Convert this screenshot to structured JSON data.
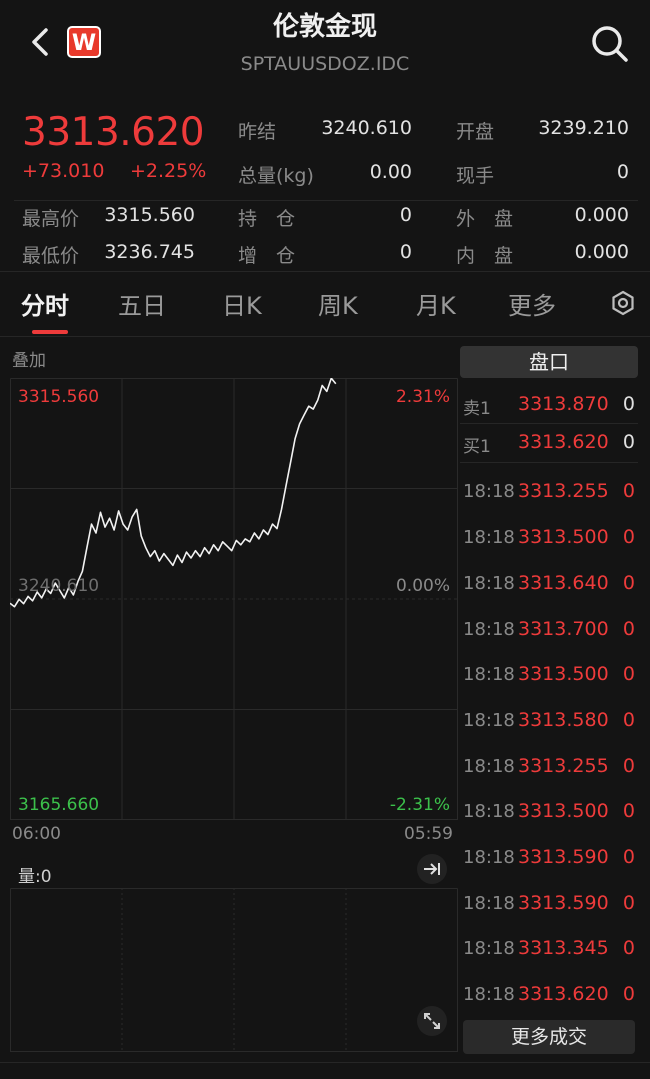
{
  "header": {
    "title": "伦敦金现",
    "subtitle": "SPTAUUSDOZ.IDC",
    "logo_letter": "W"
  },
  "quote": {
    "price": "3313.620",
    "change": "+73.010",
    "change_pct": "+2.25%",
    "fields": [
      {
        "label": "昨结",
        "value": "3240.610"
      },
      {
        "label": "开盘",
        "value": "3239.210"
      },
      {
        "label": "总量(kg)",
        "value": "0.00"
      },
      {
        "label": "现手",
        "value": "0"
      },
      {
        "label": "最高价",
        "value": "3315.560"
      },
      {
        "label": "持　仓",
        "value": "0"
      },
      {
        "label": "外　盘",
        "value": "0.000"
      },
      {
        "label": "最低价",
        "value": "3236.745"
      },
      {
        "label": "增　仓",
        "value": "0"
      },
      {
        "label": "内　盘",
        "value": "0.000"
      }
    ]
  },
  "tabs": [
    {
      "label": "分时",
      "active": true
    },
    {
      "label": "五日"
    },
    {
      "label": "日K"
    },
    {
      "label": "周K"
    },
    {
      "label": "月K"
    },
    {
      "label": "更多"
    }
  ],
  "chart_panel": {
    "overlay_label": "叠加",
    "volume_label": "量:0",
    "time_start": "06:00",
    "time_end": "05:59"
  },
  "chart_data": {
    "type": "line",
    "y_top_label": "3315.560",
    "y_mid_label": "3240.610",
    "y_bottom_label": "3165.660",
    "pct_top_label": "2.31%",
    "pct_mid_label": "0.00%",
    "pct_bottom_label": "-2.31%",
    "ylim": [
      3165.66,
      3315.56
    ],
    "x_total_points": 100,
    "values": [
      3239.2,
      3238.0,
      3240.5,
      3239.0,
      3241.5,
      3240.0,
      3243.0,
      3241.0,
      3244.0,
      3242.5,
      3246.0,
      3243.5,
      3241.0,
      3244.5,
      3242.0,
      3246.5,
      3250.0,
      3258.0,
      3266.0,
      3263.0,
      3270.0,
      3265.0,
      3268.0,
      3264.0,
      3270.5,
      3266.0,
      3264.0,
      3268.5,
      3271.0,
      3262.0,
      3258.0,
      3255.0,
      3257.0,
      3253.5,
      3256.0,
      3254.0,
      3252.0,
      3255.5,
      3253.0,
      3256.5,
      3254.5,
      3257.0,
      3255.0,
      3258.0,
      3256.0,
      3259.0,
      3257.0,
      3260.0,
      3258.5,
      3257.0,
      3260.5,
      3259.0,
      3261.0,
      3260.0,
      3263.0,
      3261.0,
      3264.0,
      3262.5,
      3266.0,
      3264.5,
      3271.0,
      3279.0,
      3287.0,
      3295.0,
      3300.0,
      3303.0,
      3306.0,
      3305.0,
      3308.0,
      3313.0,
      3311.0,
      3315.5,
      3313.6
    ]
  },
  "order_book": {
    "header": "盘口",
    "rows": [
      {
        "label": "卖1",
        "price": "3313.870",
        "qty": "0"
      },
      {
        "label": "买1",
        "price": "3313.620",
        "qty": "0"
      }
    ]
  },
  "trades": {
    "rows": [
      {
        "time": "18:18",
        "price": "3313.255",
        "qty": "0"
      },
      {
        "time": "18:18",
        "price": "3313.500",
        "qty": "0"
      },
      {
        "time": "18:18",
        "price": "3313.640",
        "qty": "0"
      },
      {
        "time": "18:18",
        "price": "3313.700",
        "qty": "0"
      },
      {
        "time": "18:18",
        "price": "3313.500",
        "qty": "0"
      },
      {
        "time": "18:18",
        "price": "3313.580",
        "qty": "0"
      },
      {
        "time": "18:18",
        "price": "3313.255",
        "qty": "0"
      },
      {
        "time": "18:18",
        "price": "3313.500",
        "qty": "0"
      },
      {
        "time": "18:18",
        "price": "3313.590",
        "qty": "0"
      },
      {
        "time": "18:18",
        "price": "3313.590",
        "qty": "0"
      },
      {
        "time": "18:18",
        "price": "3313.345",
        "qty": "0"
      },
      {
        "time": "18:18",
        "price": "3313.620",
        "qty": "0"
      }
    ],
    "more_label": "更多成交"
  },
  "colors": {
    "up": "#ee3b3b",
    "down": "#3cc04b",
    "line": "#f2f2f2",
    "background": "#141414"
  }
}
